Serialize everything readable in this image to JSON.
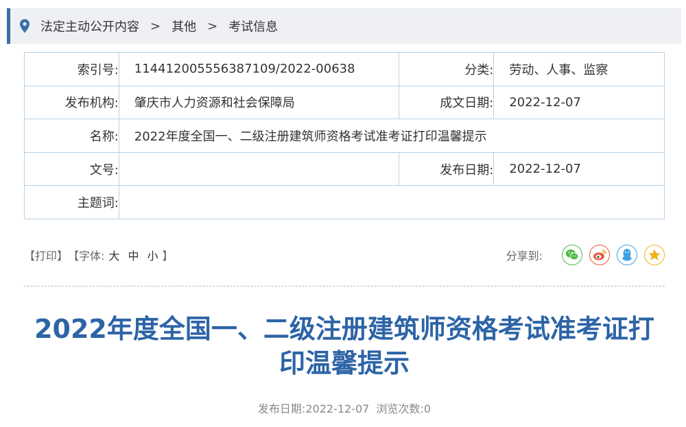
{
  "breadcrumb": {
    "icon": "location-pin-icon",
    "items": [
      "法定主动公开内容",
      "其他",
      "考试信息"
    ],
    "separator": ">"
  },
  "info": {
    "index_label": "索引号:",
    "index_value": "114412005556387109/2022-00638",
    "category_label": "分类:",
    "category_value": "劳动、人事、监察",
    "publisher_label": "发布机构:",
    "publisher_value": "肇庆市人力资源和社会保障局",
    "created_label": "成文日期:",
    "created_value": "2022-12-07",
    "name_label": "名称:",
    "name_value": "2022年度全国一、二级注册建筑师资格考试准考证打印温馨提示",
    "docno_label": "文号:",
    "docno_value": "",
    "published_label": "发布日期:",
    "published_value": "2022-12-07",
    "keywords_label": "主题词:",
    "keywords_value": ""
  },
  "toolbar": {
    "print": "【打印】",
    "font_open": "【字体:",
    "font_large": "大",
    "font_medium": "中",
    "font_small": "小",
    "font_close": "】",
    "share_label": "分享到:",
    "share_icons": [
      {
        "name": "wechat-icon",
        "color": "#4cb944"
      },
      {
        "name": "weibo-icon",
        "color": "#e8563b"
      },
      {
        "name": "qq-icon",
        "color": "#3aa2e3"
      },
      {
        "name": "qzone-icon",
        "color": "#f0b21c"
      }
    ]
  },
  "article": {
    "title": "2022年度全国一、二级注册建筑师资格考试准考证打印温馨提示",
    "meta_date_label": "发布日期:",
    "meta_date": "2022-12-07",
    "meta_views_label": "浏览次数:",
    "meta_views": "0"
  },
  "colors": {
    "accent": "#2d64a6",
    "border": "#b7d2e6",
    "breadcrumb_bg": "#eef0f3"
  }
}
